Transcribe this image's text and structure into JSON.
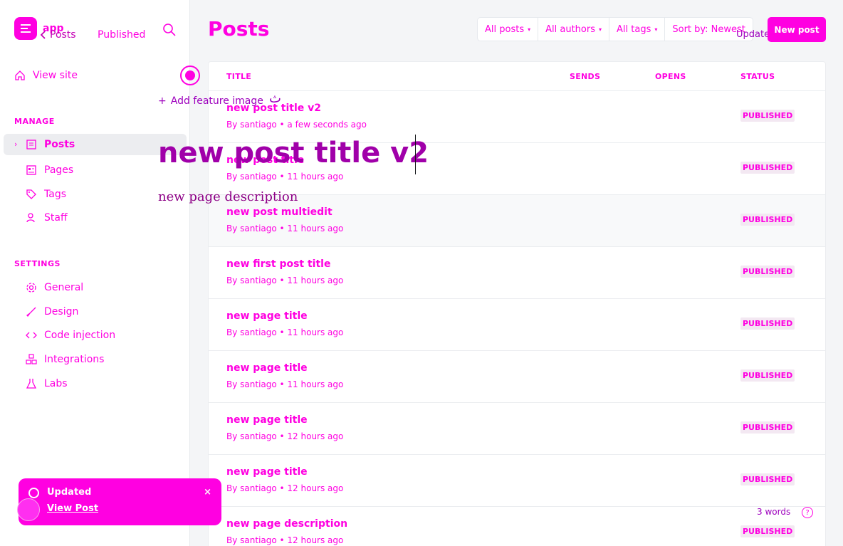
{
  "app": {
    "name": "app",
    "back_label": "Posts",
    "post_status": "Published"
  },
  "nav": {
    "view_site": "View site",
    "manage_header": "MANAGE",
    "manage_items": [
      "Posts",
      "Pages",
      "Tags",
      "Staff"
    ],
    "settings_header": "SETTINGS",
    "settings_items": [
      "General",
      "Design",
      "Code injection",
      "Integrations",
      "Labs"
    ]
  },
  "header": {
    "title": "Posts",
    "filters": [
      "All posts",
      "All authors",
      "All tags",
      "Sort by: Newest"
    ],
    "update_label": "Update",
    "new_post_label": "New post"
  },
  "table": {
    "columns": [
      "TITLE",
      "SENDS",
      "OPENS",
      "STATUS"
    ],
    "rows": [
      {
        "title": "new post title v2",
        "meta": "By santiago • a few seconds ago",
        "status": "PUBLISHED"
      },
      {
        "title": "new post title",
        "meta": "By santiago • 11 hours ago",
        "status": "PUBLISHED"
      },
      {
        "title": "new post multiedit",
        "meta": "By santiago • 11 hours ago",
        "status": "PUBLISHED"
      },
      {
        "title": "new first post title",
        "meta": "By santiago • 11 hours ago",
        "status": "PUBLISHED"
      },
      {
        "title": "new page title",
        "meta": "By santiago • 11 hours ago",
        "status": "PUBLISHED"
      },
      {
        "title": "new page title",
        "meta": "By santiago • 11 hours ago",
        "status": "PUBLISHED"
      },
      {
        "title": "new page title",
        "meta": "By santiago • 12 hours ago",
        "status": "PUBLISHED"
      },
      {
        "title": "new page title",
        "meta": "By santiago • 12 hours ago",
        "status": "PUBLISHED"
      },
      {
        "title": "new page description",
        "meta": "By santiago • 12 hours ago",
        "status": "PUBLISHED"
      }
    ]
  },
  "editor": {
    "add_feature_image": "Add feature image",
    "title": "new post title v2",
    "description": "new page description",
    "word_count": "3 words",
    "help": "?"
  },
  "toast": {
    "title": "Updated",
    "link": "View Post",
    "close": "×"
  },
  "colors": {
    "accent": "#ff00e1",
    "accent_dark": "#a000a9",
    "background": "#f4f5f7"
  }
}
